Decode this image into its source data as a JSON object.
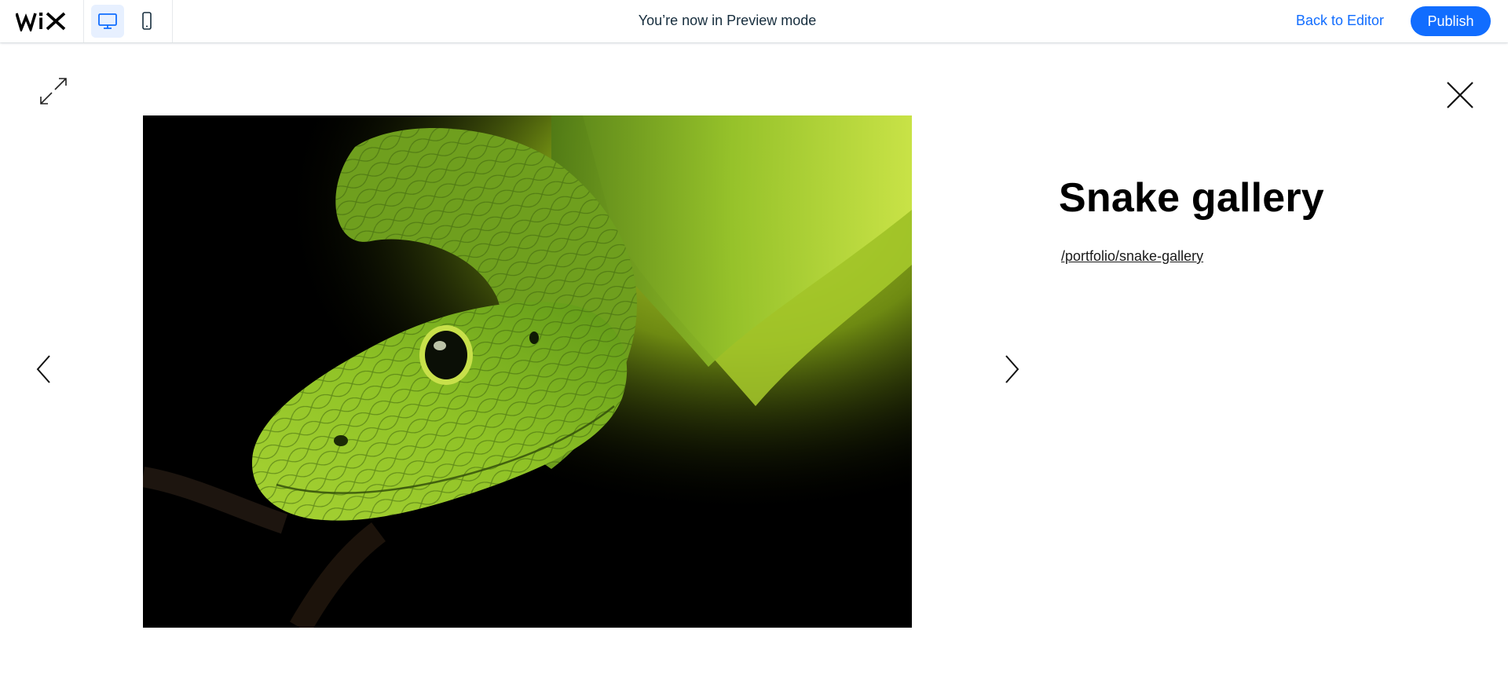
{
  "topbar": {
    "logo": "WiX",
    "preview_message": "You’re now in Preview mode",
    "back_label": "Back to Editor",
    "publish_label": "Publish",
    "accent_color": "#116dff",
    "devices": [
      {
        "icon": "desktop-icon",
        "active": true
      },
      {
        "icon": "mobile-icon",
        "active": false
      }
    ]
  },
  "lightbox": {
    "title": "Snake gallery",
    "slug": "/portfolio/snake-gallery",
    "image": "green-snake-photo",
    "icons": [
      "expand-icon",
      "close-icon",
      "chevron-left-icon",
      "chevron-right-icon"
    ]
  }
}
